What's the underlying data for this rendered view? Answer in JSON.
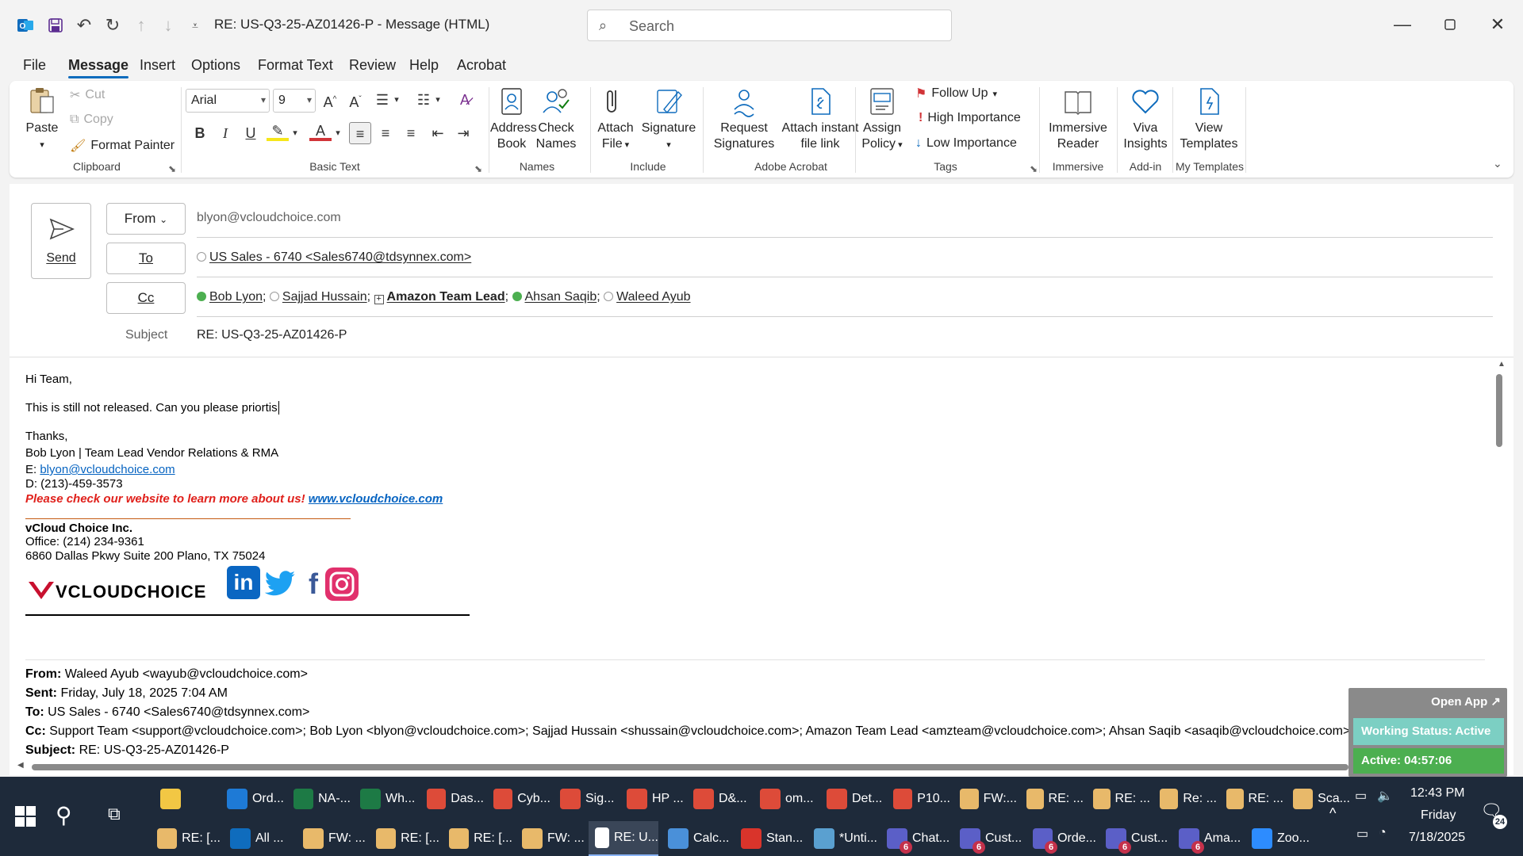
{
  "titlebar": {
    "title": "RE: US-Q3-25-AZ01426-P  -  Message (HTML)",
    "search_placeholder": "Search"
  },
  "menu": {
    "tabs": [
      "File",
      "Message",
      "Insert",
      "Options",
      "Format Text",
      "Review",
      "Help",
      "Acrobat"
    ],
    "active": "Message"
  },
  "ribbon": {
    "clipboard": {
      "paste": "Paste",
      "cut": "Cut",
      "copy": "Copy",
      "format_painter": "Format Painter",
      "label": "Clipboard"
    },
    "basic_text": {
      "font": "Arial",
      "size": "9",
      "label": "Basic Text"
    },
    "names": {
      "address_book_1": "Address",
      "address_book_2": "Book",
      "check_names_1": "Check",
      "check_names_2": "Names",
      "label": "Names"
    },
    "include": {
      "attach_1": "Attach",
      "attach_2": "File",
      "signature": "Signature",
      "label": "Include"
    },
    "adobe": {
      "request_1": "Request",
      "request_2": "Signatures",
      "instant_1": "Attach instant",
      "instant_2": "file link",
      "label": "Adobe Acrobat"
    },
    "tags": {
      "assign_1": "Assign",
      "assign_2": "Policy",
      "follow_up": "Follow Up",
      "high": "High Importance",
      "low": "Low Importance",
      "label": "Tags"
    },
    "immersive": {
      "reader_1": "Immersive",
      "reader_2": "Reader",
      "label": "Immersive"
    },
    "addin": {
      "viva_1": "Viva",
      "viva_2": "Insights",
      "label": "Add-in"
    },
    "templates": {
      "view_1": "View",
      "view_2": "Templates",
      "label": "My Templates"
    }
  },
  "compose": {
    "send": "Send",
    "from_label": "From",
    "from_value": "blyon@vcloudchoice.com",
    "to_label": "To",
    "to_value": "US Sales - 6740 <Sales6740@tdsynnex.com>",
    "cc_label": "Cc",
    "cc": [
      {
        "name": "Bob Lyon",
        "status": "green"
      },
      {
        "name": "Sajjad Hussain",
        "status": "empty"
      },
      {
        "name": "Amazon Team Lead",
        "status": "group"
      },
      {
        "name": "Ahsan Saqib",
        "status": "green"
      },
      {
        "name": "Waleed Ayub",
        "status": "empty"
      }
    ],
    "subject_label": "Subject",
    "subject_value": "RE: US-Q3-25-AZ01426-P"
  },
  "body": {
    "greeting": "Hi Team,",
    "message": "This is still not released. Can you please priortis",
    "thanks": "Thanks,",
    "sig_name": "Bob Lyon | Team Lead Vendor Relations & RMA",
    "sig_email_label": "E: ",
    "sig_email": "blyon@vcloudchoice.com",
    "sig_phone": "D: (213)-459-3573",
    "promo_text": "Please check our website to learn more about us! ",
    "promo_link": "www.vcloudchoice.com",
    "company": "vCloud Choice Inc.",
    "office": "Office: (214) 234-9361",
    "address": "6860 Dallas Pkwy Suite 200 Plano, TX 75024",
    "logo_text": "VCLOUDCHOICE"
  },
  "quoted": {
    "from_label": "From:",
    "from_value": " Waleed Ayub <wayub@vcloudchoice.com>",
    "sent_label": "Sent:",
    "sent_value": " Friday, July 18, 2025 7:04 AM",
    "to_label": "To:",
    "to_value": " US Sales - 6740 <Sales6740@tdsynnex.com>",
    "cc_label": "Cc:",
    "cc_value": " Support Team <support@vcloudchoice.com>; Bob Lyon <blyon@vcloudchoice.com>; Sajjad Hussain <shussain@vcloudchoice.com>; Amazon Team Lead <amzteam@vcloudchoice.com>; Ahsan Saqib <asaqib@vcloudchoice.com>",
    "subject_label": "Subject:",
    "subject_value": " RE: US-Q3-25-AZ01426-P"
  },
  "widget": {
    "open_app": "Open App ↗",
    "working_status": "Working Status: Active",
    "active_time": "Active: 04:57:06"
  },
  "taskbar": {
    "row1": [
      {
        "label": "",
        "color": "#f2c744",
        "icon": "folder-icon"
      },
      {
        "label": "Ord...",
        "color": "#1e7ad6",
        "icon": "edge-icon"
      },
      {
        "label": "NA-...",
        "color": "#1d7a45",
        "icon": "excel-icon"
      },
      {
        "label": "Wh...",
        "color": "#1d7a45",
        "icon": "excel-icon"
      },
      {
        "label": "Das...",
        "color": "#dd4b39",
        "icon": "chrome-icon"
      },
      {
        "label": "Cyb...",
        "color": "#dd4b39",
        "icon": "chrome-icon"
      },
      {
        "label": "Sig...",
        "color": "#dd4b39",
        "icon": "chrome-icon"
      },
      {
        "label": "HP ...",
        "color": "#dd4b39",
        "icon": "chrome-icon"
      },
      {
        "label": "D&...",
        "color": "#dd4b39",
        "icon": "chrome-icon"
      },
      {
        "label": "om...",
        "color": "#dd4b39",
        "icon": "chrome-icon"
      },
      {
        "label": "Det...",
        "color": "#dd4b39",
        "icon": "chrome-icon"
      },
      {
        "label": "P10...",
        "color": "#dd4b39",
        "icon": "chrome-icon"
      },
      {
        "label": "FW:...",
        "color": "#e8b96a",
        "icon": "mail-icon"
      },
      {
        "label": "RE: ...",
        "color": "#e8b96a",
        "icon": "mail-icon"
      },
      {
        "label": "RE: ...",
        "color": "#e8b96a",
        "icon": "mail-icon"
      },
      {
        "label": "Re: ...",
        "color": "#e8b96a",
        "icon": "mail-icon"
      },
      {
        "label": "RE: ...",
        "color": "#e8b96a",
        "icon": "mail-icon"
      },
      {
        "label": "Sca...",
        "color": "#e8b96a",
        "icon": "mail-icon"
      }
    ],
    "row2": [
      {
        "label": "RE: [...",
        "color": "#e8b96a",
        "icon": "mail-icon"
      },
      {
        "label": "All ...",
        "color": "#0f6cbd",
        "icon": "outlook-icon"
      },
      {
        "label": "FW: ...",
        "color": "#e8b96a",
        "icon": "mail-icon"
      },
      {
        "label": "RE: [...",
        "color": "#e8b96a",
        "icon": "mail-icon"
      },
      {
        "label": "RE: [...",
        "color": "#e8b96a",
        "icon": "mail-icon"
      },
      {
        "label": "FW: ...",
        "color": "#e8b96a",
        "icon": "mail-icon"
      },
      {
        "label": "RE: U...",
        "color": "#ffffff",
        "icon": "mail-icon",
        "active": true
      },
      {
        "label": "Calc...",
        "color": "#4a90d9",
        "icon": "calculator-icon"
      },
      {
        "label": "Stan...",
        "color": "#d9342b",
        "icon": "pdf-icon"
      },
      {
        "label": "*Unti...",
        "color": "#5aa0d0",
        "icon": "notepad-icon"
      },
      {
        "label": "Chat...",
        "color": "#5b5fc7",
        "icon": "teams-icon",
        "badge": "6"
      },
      {
        "label": "Cust...",
        "color": "#5b5fc7",
        "icon": "teams-icon",
        "badge": "6"
      },
      {
        "label": "Orde...",
        "color": "#5b5fc7",
        "icon": "teams-icon",
        "badge": "6"
      },
      {
        "label": "Cust...",
        "color": "#5b5fc7",
        "icon": "teams-icon",
        "badge": "6"
      },
      {
        "label": "Ama...",
        "color": "#5b5fc7",
        "icon": "teams-icon",
        "badge": "6"
      },
      {
        "label": "Zoo...",
        "color": "#2d8cff",
        "icon": "zoom-icon"
      }
    ],
    "time": "12:43 PM",
    "day": "Friday",
    "date": "7/18/2025",
    "notifications": "24"
  }
}
